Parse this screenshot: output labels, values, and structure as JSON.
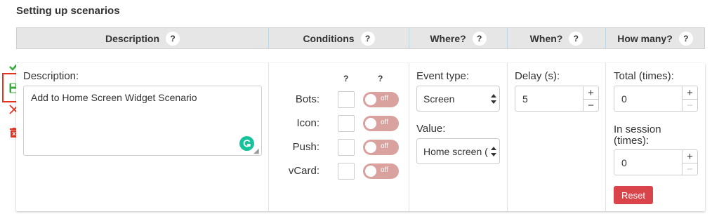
{
  "page": {
    "title": "Setting up scenarios"
  },
  "header": {
    "columns": [
      {
        "label": "Description",
        "help": "?"
      },
      {
        "label": "Conditions",
        "help": "?"
      },
      {
        "label": "Where?",
        "help": "?"
      },
      {
        "label": "When?",
        "help": "?"
      },
      {
        "label": "How many?",
        "help": "?"
      }
    ]
  },
  "toolbar": {
    "icons": [
      "check-icon",
      "save-icon",
      "close-icon",
      "delete-icon"
    ]
  },
  "description": {
    "label": "Description:",
    "value": "Add to Home Screen Widget Scenario"
  },
  "conditions": {
    "help1": "?",
    "help2": "?",
    "toggle_text": "off",
    "rows": [
      {
        "label": "Bots:"
      },
      {
        "label": "Icon:"
      },
      {
        "label": "Push:"
      },
      {
        "label": "vCard:"
      }
    ]
  },
  "where": {
    "event_type_label": "Event type:",
    "event_type_value": "Screen",
    "value_label": "Value:",
    "value_value": "Home screen (",
    "value_full": "Home screen (widget)"
  },
  "when": {
    "delay_label": "Delay (s):",
    "delay_value": "5"
  },
  "how_many": {
    "total_label": "Total (times):",
    "total_value": "0",
    "session_label_1": "In session",
    "session_label_2": "(times):",
    "session_value": "0",
    "reset_label": "Reset"
  },
  "colors": {
    "check": "#3aa93e",
    "save": "#3aa93e",
    "close": "#e53322",
    "delete": "#e53322",
    "highlight": "#e53322",
    "toggle_off": "#d9a29f",
    "reset": "#d9434a",
    "grammarly": "#15c39a"
  }
}
